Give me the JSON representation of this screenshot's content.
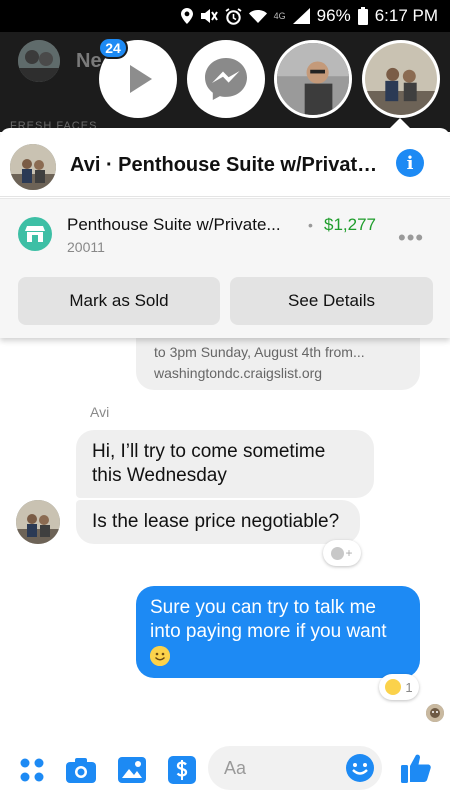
{
  "status_bar": {
    "network_label": "4G",
    "battery": "96%",
    "time": "6:17 PM"
  },
  "background": {
    "title": "Ne",
    "section_label": "FRESH FACES"
  },
  "chat_heads": {
    "badge_count": "24"
  },
  "conversation": {
    "title": "Avi · Penthouse Suite w/Private..."
  },
  "listing": {
    "title": "Penthouse Suite w/Private...",
    "price": "$1,277",
    "zip": "20011",
    "mark_sold_label": "Mark as Sold",
    "see_details_label": "See Details",
    "accent_color": "#3dbfa5"
  },
  "messages": {
    "link_preview_line1": "to 3pm Sunday, August 4th from...",
    "link_preview_line2": "washingtondc.craigslist.org",
    "sender_name": "Avi",
    "incoming_1": "Hi, I’ll try to come sometime this Wednesday",
    "incoming_2": "Is the lease price negotiable?",
    "outgoing_1": "Sure you can try to talk me into paying more if you want",
    "reaction_count": "1"
  },
  "composer": {
    "placeholder": "Aa"
  },
  "colors": {
    "messenger_blue": "#1d8af4",
    "price_green": "#1f9d2b"
  },
  "icons": [
    "location-icon",
    "mute-icon",
    "alarm-icon",
    "wifi-icon",
    "signal-icon",
    "battery-icon",
    "play-icon",
    "messenger-icon",
    "info-icon",
    "shop-icon",
    "more-icon",
    "apps-icon",
    "camera-icon",
    "gallery-icon",
    "payment-icon",
    "emoji-icon",
    "like-icon"
  ]
}
